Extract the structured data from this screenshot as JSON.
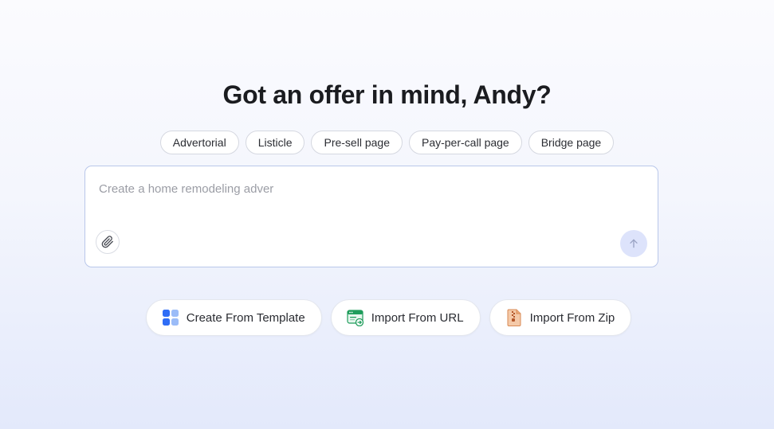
{
  "headline": "Got an offer in mind, Andy?",
  "chips": [
    {
      "label": "Advertorial"
    },
    {
      "label": "Listicle"
    },
    {
      "label": "Pre-sell page"
    },
    {
      "label": "Pay-per-call page"
    },
    {
      "label": "Bridge page"
    }
  ],
  "prompt": {
    "placeholder": "Create a home remodeling adver",
    "attach_icon": "paperclip-icon",
    "send_icon": "arrow-up-icon"
  },
  "actions": [
    {
      "label": "Create From Template",
      "icon": "template-grid-icon"
    },
    {
      "label": "Import From URL",
      "icon": "browser-link-icon"
    },
    {
      "label": "Import From Zip",
      "icon": "zip-file-icon"
    }
  ],
  "colors": {
    "accent_blue": "#2f6df6",
    "send_button_bg": "#dde3fb",
    "input_border": "#b9c7ea"
  }
}
